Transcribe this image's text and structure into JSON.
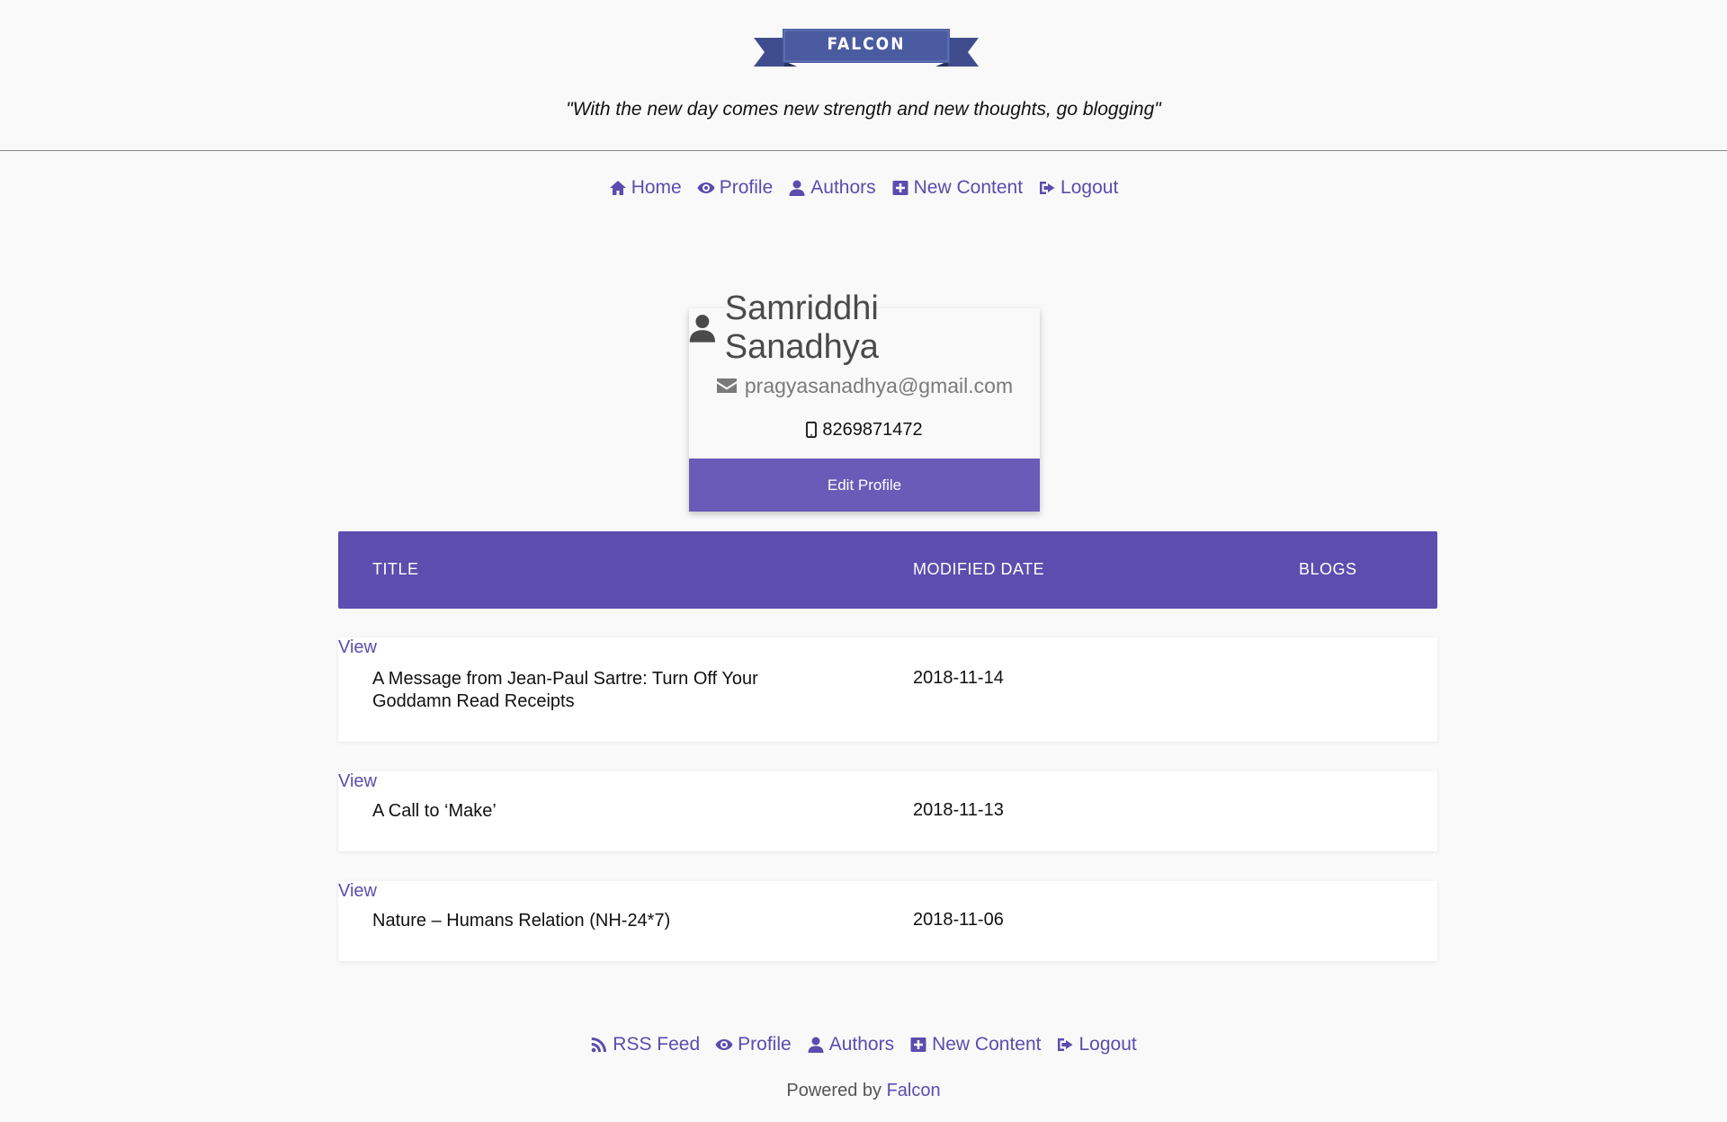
{
  "brand": {
    "logo_text": "FALCON",
    "tagline": "\"With the new day comes new strength and new thoughts, go blogging\""
  },
  "nav": [
    {
      "label": "Home",
      "icon": "home-icon"
    },
    {
      "label": "Profile",
      "icon": "eye-icon"
    },
    {
      "label": "Authors",
      "icon": "user-icon"
    },
    {
      "label": "New Content",
      "icon": "plus-square-icon"
    },
    {
      "label": "Logout",
      "icon": "sign-out-icon"
    }
  ],
  "profile": {
    "name": "Samriddhi Sanadhya",
    "email": "pragyasanadhya@gmail.com",
    "phone": "8269871472",
    "edit_label": "Edit Profile"
  },
  "table": {
    "headers": [
      "TITLE",
      "MODIFIED DATE",
      "BLOGS"
    ],
    "rows": [
      {
        "title": "A Message from Jean-Paul Sartre: Turn Off Your Goddamn Read Receipts",
        "date": "2018-11-14",
        "action": "View"
      },
      {
        "title": "A Call to ‘Make’",
        "date": "2018-11-13",
        "action": "View"
      },
      {
        "title": "Nature – Humans Relation (NH-24*7)",
        "date": "2018-11-06",
        "action": "View"
      }
    ]
  },
  "footer": {
    "nav": [
      {
        "label": "RSS Feed",
        "icon": "rss-icon"
      },
      {
        "label": "Profile",
        "icon": "eye-icon"
      },
      {
        "label": "Authors",
        "icon": "user-icon"
      },
      {
        "label": "New Content",
        "icon": "plus-square-icon"
      },
      {
        "label": "Logout",
        "icon": "sign-out-icon"
      }
    ],
    "powered_prefix": "Powered by",
    "powered_link": "Falcon"
  },
  "colors": {
    "accent": "#5c4daf",
    "button": "#6a5bb8",
    "link": "#5b4cae",
    "background": "#f9f9f9"
  }
}
